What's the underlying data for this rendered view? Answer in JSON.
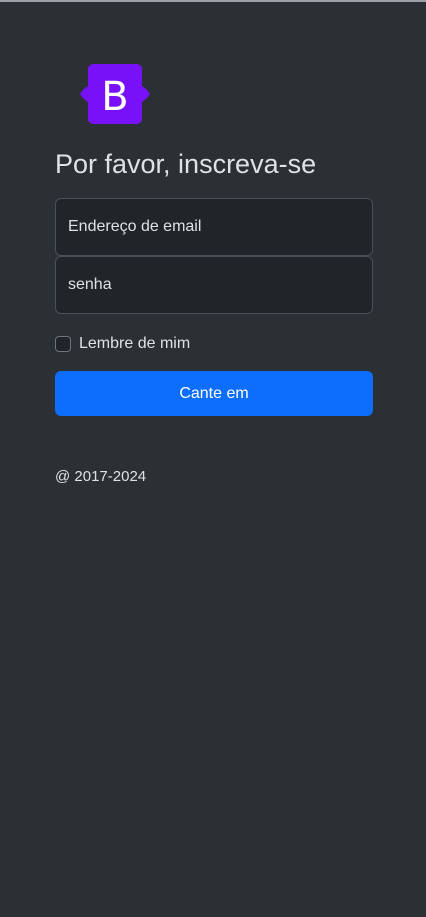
{
  "logo": {
    "letter": "B",
    "icon": "bootstrap-logo-icon",
    "color": "#7811f7"
  },
  "form": {
    "heading": "Por favor, inscreva-se",
    "email_placeholder": "Endereço de email",
    "password_placeholder": "senha",
    "remember_label": "Lembre de mim",
    "remember_checked": false,
    "submit_label": "Cante em"
  },
  "footer": {
    "copyright": "@ 2017-2024"
  },
  "colors": {
    "background": "#2b3035",
    "field_background": "#212529",
    "primary": "#0d6efd"
  }
}
